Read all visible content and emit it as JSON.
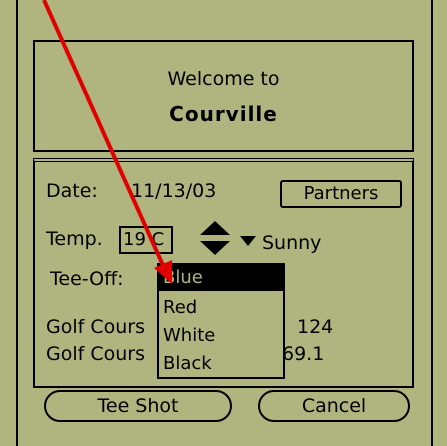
{
  "welcome": {
    "line1": "Welcome to",
    "app_name": "Courville"
  },
  "form": {
    "date_label": "Date:",
    "date_value": "11/13/03",
    "partners_label": "Partners",
    "temp_label": "Temp.",
    "temp_value": "19 C",
    "weather_value": "Sunny",
    "teeoff_label": "Tee-Off:",
    "golf_rows": [
      {
        "label": "Golf Cours",
        "value": "124"
      },
      {
        "label": "Golf Cours",
        "value": "69.1"
      }
    ]
  },
  "dropdown": {
    "options": [
      "Blue",
      "Red",
      "White",
      "Black"
    ],
    "selected": "Blue"
  },
  "buttons": {
    "tee_shot": "Tee Shot",
    "cancel": "Cancel"
  },
  "colors": {
    "background": "#b0b47e",
    "foreground": "#000000",
    "annotation_arrow": "#e00000"
  },
  "icons": {
    "updown": "updown-arrows-icon",
    "dropdown": "dropdown-triangle-icon",
    "annotation": "red-arrow-icon"
  }
}
